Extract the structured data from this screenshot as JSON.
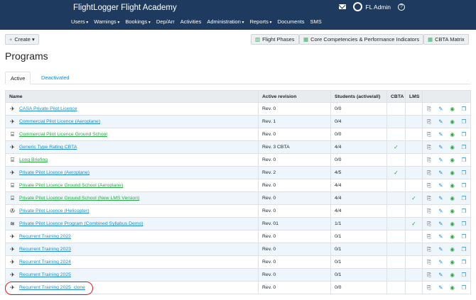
{
  "app": {
    "title": "FlightLogger Flight Academy",
    "user": "FL Admin"
  },
  "nav": [
    {
      "label": "Users",
      "caret": true
    },
    {
      "label": "Warnings",
      "caret": true
    },
    {
      "label": "Bookings",
      "caret": true
    },
    {
      "label": "Dep/Arr",
      "caret": false
    },
    {
      "label": "Activities",
      "caret": false
    },
    {
      "label": "Administration",
      "caret": true
    },
    {
      "label": "Reports",
      "caret": true
    },
    {
      "label": "Documents",
      "caret": false
    },
    {
      "label": "SMS",
      "caret": false
    }
  ],
  "toolbar": {
    "create": "Create",
    "flight_phases": "Flight Phases",
    "core_competencies": "Core Competencies & Performance Indicators",
    "cbta_matrix": "CBTA Matrix"
  },
  "page": {
    "title": "Programs"
  },
  "tabs": {
    "active": "Active",
    "deactivated": "Deactivated"
  },
  "table": {
    "headers": [
      "Name",
      "Active revision",
      "Students (active/all)",
      "CBTA",
      "LMS"
    ],
    "rows": [
      {
        "icon": "airplane-icon",
        "name": "CASA Private Pilot Licence",
        "revision": "Rev. 0",
        "students": "0/0",
        "cbta": "",
        "lms": "",
        "green": false
      },
      {
        "icon": "airplane-icon",
        "name": "Commercial Pilot Licence (Aeroplane)",
        "revision": "Rev. 1",
        "students": "0/4",
        "cbta": "",
        "lms": "",
        "green": false
      },
      {
        "icon": "classroom-icon",
        "name": "Commercial Pilot Licence Ground School",
        "revision": "Rev. 0",
        "students": "0/0",
        "cbta": "",
        "lms": "",
        "green": true
      },
      {
        "icon": "airplane-icon",
        "name": "Generic Type Rating CBTA",
        "revision": "Rev. 3 CBTA",
        "students": "4/4",
        "cbta": "✓",
        "lms": "",
        "green": false
      },
      {
        "icon": "classroom-icon",
        "name": "Long Briefing",
        "revision": "Rev. 0",
        "students": "0/0",
        "cbta": "",
        "lms": "",
        "green": true
      },
      {
        "icon": "airplane-icon",
        "name": "Private Pilot Licence (Aeroplane)",
        "revision": "Rev. 2",
        "students": "4/5",
        "cbta": "✓",
        "lms": "",
        "green": false
      },
      {
        "icon": "classroom-icon",
        "name": "Private Pilot Licence Ground School (Aeroplane)",
        "revision": "Rev. 0",
        "students": "4/4",
        "cbta": "",
        "lms": "",
        "green": true
      },
      {
        "icon": "classroom-icon",
        "name": "Private Pilot Licence Ground School (New LMS Version)",
        "revision": "Rev. 0",
        "students": "4/4",
        "cbta": "",
        "lms": "✓",
        "green": true
      },
      {
        "icon": "helicopter-icon",
        "name": "Private Pilot Licence (Helicopter)",
        "revision": "Rev. 0",
        "students": "4/4",
        "cbta": "",
        "lms": "",
        "green": false
      },
      {
        "icon": "layers-icon",
        "name": "Private Pilot Licence Program (Combined Syllabus Demo)",
        "revision": "Rev. 01",
        "students": "1/1",
        "cbta": "",
        "lms": "✓",
        "green": false
      },
      {
        "icon": "airplane-icon",
        "name": "Recurrent Training 2022",
        "revision": "Rev. 0",
        "students": "0/1",
        "cbta": "",
        "lms": "",
        "green": false
      },
      {
        "icon": "airplane-icon",
        "name": "Recurrent Training 2023",
        "revision": "Rev. 0",
        "students": "0/1",
        "cbta": "",
        "lms": "",
        "green": false
      },
      {
        "icon": "airplane-icon",
        "name": "Recurrent Training 2024",
        "revision": "Rev. 0",
        "students": "0/1",
        "cbta": "",
        "lms": "",
        "green": false
      },
      {
        "icon": "airplane-icon",
        "name": "Recurrent Training 2025",
        "revision": "Rev. 0",
        "students": "0/1",
        "cbta": "",
        "lms": "",
        "green": false
      },
      {
        "icon": "airplane-icon",
        "name": "Recurrent Training 2025_clone",
        "revision": "Rev. 0",
        "students": "0/0",
        "cbta": "",
        "lms": "",
        "green": false
      }
    ]
  }
}
